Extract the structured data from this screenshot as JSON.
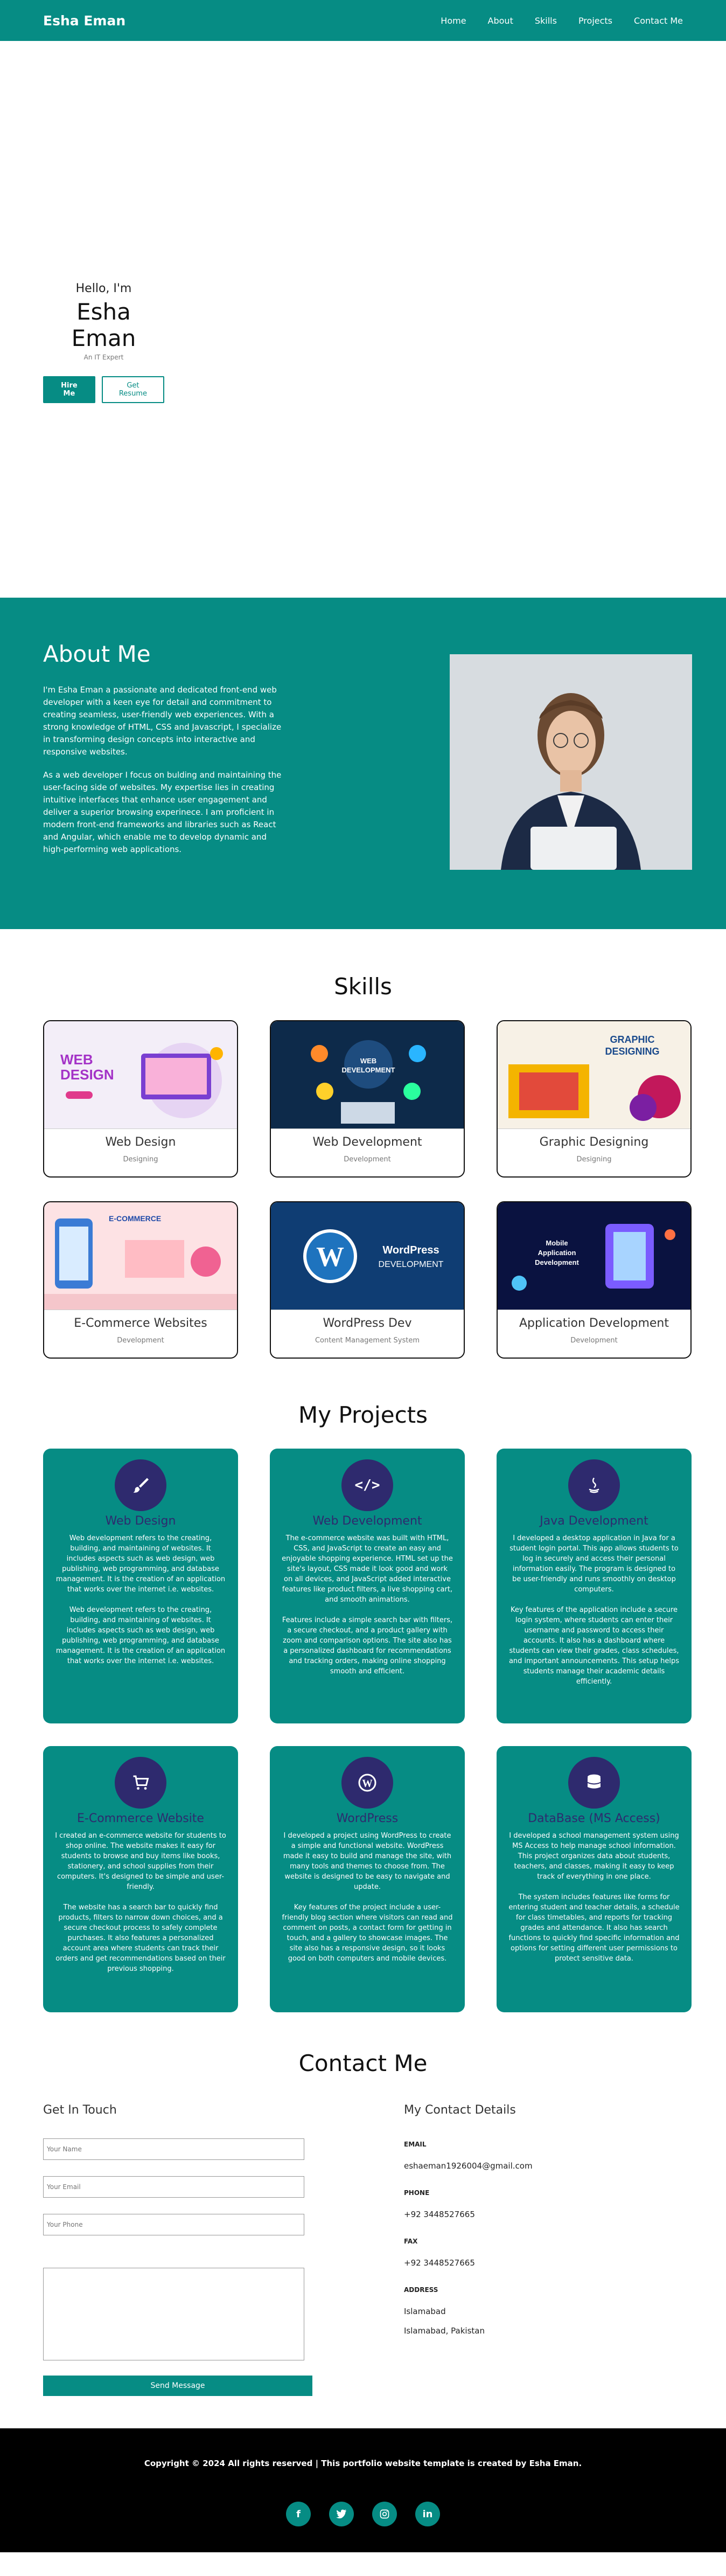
{
  "nav": {
    "brand": "Esha Eman",
    "links": [
      "Home",
      "About",
      "Skills",
      "Projects",
      "Contact Me"
    ]
  },
  "hero": {
    "greeting": "Hello, I'm",
    "name": "Esha Eman",
    "tagline": "An IT Expert",
    "hire_label": "Hire Me",
    "resume_label": "Get Resume"
  },
  "about": {
    "title": "About Me",
    "p1": "I'm Esha Eman a passionate and dedicated front-end web developer with a keen eye for detail and commitment to creating seamless, user-friendly web experiences. With a strong knowledge of HTML, CSS and Javascript, I specialize in transforming design concepts into interactive and responsive websites.",
    "p2": "As a web developer I focus on bulding and maintaining the user-facing side of websites. My expertise lies in creating intuitive interfaces that enhance user engagement and deliver a superior browsing experinece. I am proficient in modern front-end frameworks and libraries such as React and Angular, which enable me to develop dynamic and high-performing web applications."
  },
  "skills": {
    "title": "Skills",
    "items": [
      {
        "title": "Web Design",
        "sub": "Designing",
        "img": "WEB DESIGN"
      },
      {
        "title": "Web Development",
        "sub": "Development",
        "img": "WEB DEVELOPMENT"
      },
      {
        "title": "Graphic Designing",
        "sub": "Designing",
        "img": "GRAPHIC DESIGNING"
      },
      {
        "title": "E-Commerce Websites",
        "sub": "Development",
        "img": "E-COMMERCE"
      },
      {
        "title": "WordPress Dev",
        "sub": "Content Management System",
        "img": "WordPress DEVELOPMENT"
      },
      {
        "title": "Application Development",
        "sub": "Development",
        "img": "Mobile Application Development"
      }
    ]
  },
  "projects": {
    "title": "My Projects",
    "items": [
      {
        "title": "Web Design",
        "icon": "brush-icon",
        "desc1": "Web development refers to the creating, building, and maintaining of websites. It includes aspects such as web design, web publishing, web programming, and database management. It is the creation of an application that works over the internet i.e. websites.",
        "desc2": "Web development refers to the creating, building, and maintaining of websites. It includes aspects such as web design, web publishing, web programming, and database management. It is the creation of an application that works over the internet i.e. websites."
      },
      {
        "title": "Web Development",
        "icon": "code-icon",
        "desc1": "The e-commerce website was built with HTML, CSS, and JavaScript to create an easy and enjoyable shopping experience. HTML set up the site's layout, CSS made it look good and work on all devices, and JavaScript added interactive features like product filters, a live shopping cart, and smooth animations.",
        "desc2": "Features include a simple search bar with filters, a secure checkout, and a product gallery with zoom and comparison options. The site also has a personalized dashboard for recommendations and tracking orders, making online shopping smooth and efficient."
      },
      {
        "title": "Java Development",
        "icon": "java-icon",
        "desc1": "I developed a desktop application in Java for a student login portal. This app allows students to log in securely and access their personal information easily. The program is designed to be user-friendly and runs smoothly on desktop computers.",
        "desc2": "Key features of the application include a secure login system, where students can enter their username and password to access their accounts. It also has a dashboard where students can view their grades, class schedules, and important announcements. This setup helps students manage their academic details efficiently."
      },
      {
        "title": "E-Commerce Website",
        "icon": "cart-icon",
        "desc1": "I created an e-commerce website for students to shop online. The website makes it easy for students to browse and buy items like books, stationery, and school supplies from their computers. It's designed to be simple and user-friendly.",
        "desc2": "The website has a search bar to quickly find products, filters to narrow down choices, and a secure checkout process to safely complete purchases. It also features a personalized account area where students can track their orders and get recommendations based on their previous shopping."
      },
      {
        "title": "WordPress",
        "icon": "wordpress-icon",
        "desc1": "I developed a project using WordPress to create a simple and functional website. WordPress made it easy to build and manage the site, with many tools and themes to choose from. The website is designed to be easy to navigate and update.",
        "desc2": "Key features of the project include a user-friendly blog section where visitors can read and comment on posts, a contact form for getting in touch, and a gallery to showcase images. The site also has a responsive design, so it looks good on both computers and mobile devices."
      },
      {
        "title": "DataBase (MS Access)",
        "icon": "database-icon",
        "desc1": "I developed a school management system using MS Access to help manage school information. This project organizes data about students, teachers, and classes, making it easy to keep track of everything in one place.",
        "desc2": "The system includes features like forms for entering student and teacher details, a schedule for class timetables, and reports for tracking grades and attendance. It also has search functions to quickly find specific information and options for setting different user permissions to protect sensitive data."
      }
    ]
  },
  "contact": {
    "title": "Contact Me",
    "form_title": "Get In Touch",
    "name_ph": "Your Name",
    "email_ph": "Your Email",
    "phone_ph": "Your Phone",
    "send_label": "Send Message",
    "details_title": "My Contact Details",
    "email_label": "EMAIL",
    "email": "eshaeman1926004@gmail.com",
    "phone_label": "PHONE",
    "phone": "+92 3448527665",
    "fax_label": "FAX",
    "fax": "+92 3448527665",
    "address_label": "ADDRESS",
    "address1": "Islamabad",
    "address2": "Islamabad, Pakistan"
  },
  "footer": {
    "copyright": "Copyright © 2024 All rights reserved | This portfolio website template is created by Esha Eman.",
    "social": [
      "facebook-icon",
      "twitter-icon",
      "instagram-icon",
      "linkedin-icon"
    ]
  },
  "colors": {
    "primary": "#068c84",
    "dark": "#2e2a6e"
  }
}
